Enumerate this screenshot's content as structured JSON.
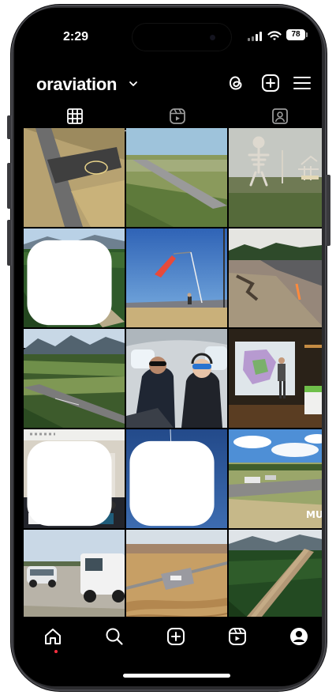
{
  "status": {
    "time": "2:29",
    "battery": "78"
  },
  "profile": {
    "username": "oraviation"
  },
  "icons": {
    "threads": "threads-icon",
    "create": "plus-square-icon",
    "menu": "hamburger-menu-icon",
    "grid_tab": "grid-icon",
    "reels_tab": "reels-icon",
    "tagged_tab": "tagged-person-icon"
  },
  "posts": [
    {
      "subject": "aerial runway intersection",
      "multi": false
    },
    {
      "subject": "airstrip in farmland aerial",
      "multi": false
    },
    {
      "subject": "dinosaur skeleton sculptures",
      "multi": false
    },
    {
      "subject": "forest airstrip aerial",
      "multi": true
    },
    {
      "subject": "windsock against blue sky",
      "multi": false
    },
    {
      "subject": "runway edge with cones",
      "multi": false
    },
    {
      "subject": "valley airport aerial",
      "multi": false
    },
    {
      "subject": "two pilots in cockpit",
      "multi": false
    },
    {
      "subject": "presentation on stage",
      "multi": false
    },
    {
      "subject": "conference room audience",
      "multi": true
    },
    {
      "subject": "contrail in blue sky",
      "multi": true
    },
    {
      "subject": "airport with MULINO marking",
      "multi": false,
      "marking": "MULIN"
    },
    {
      "subject": "trucks parked on gravel",
      "multi": false
    },
    {
      "subject": "desert airfield aerial",
      "multi": false
    },
    {
      "subject": "airstrip cut in forest",
      "multi": false
    }
  ],
  "nav": [
    "home-icon",
    "search-icon",
    "create-icon",
    "reels-icon",
    "profile-icon"
  ],
  "colors": {
    "background": "#000000",
    "foreground": "#ffffff",
    "notification": "#ff3040"
  }
}
